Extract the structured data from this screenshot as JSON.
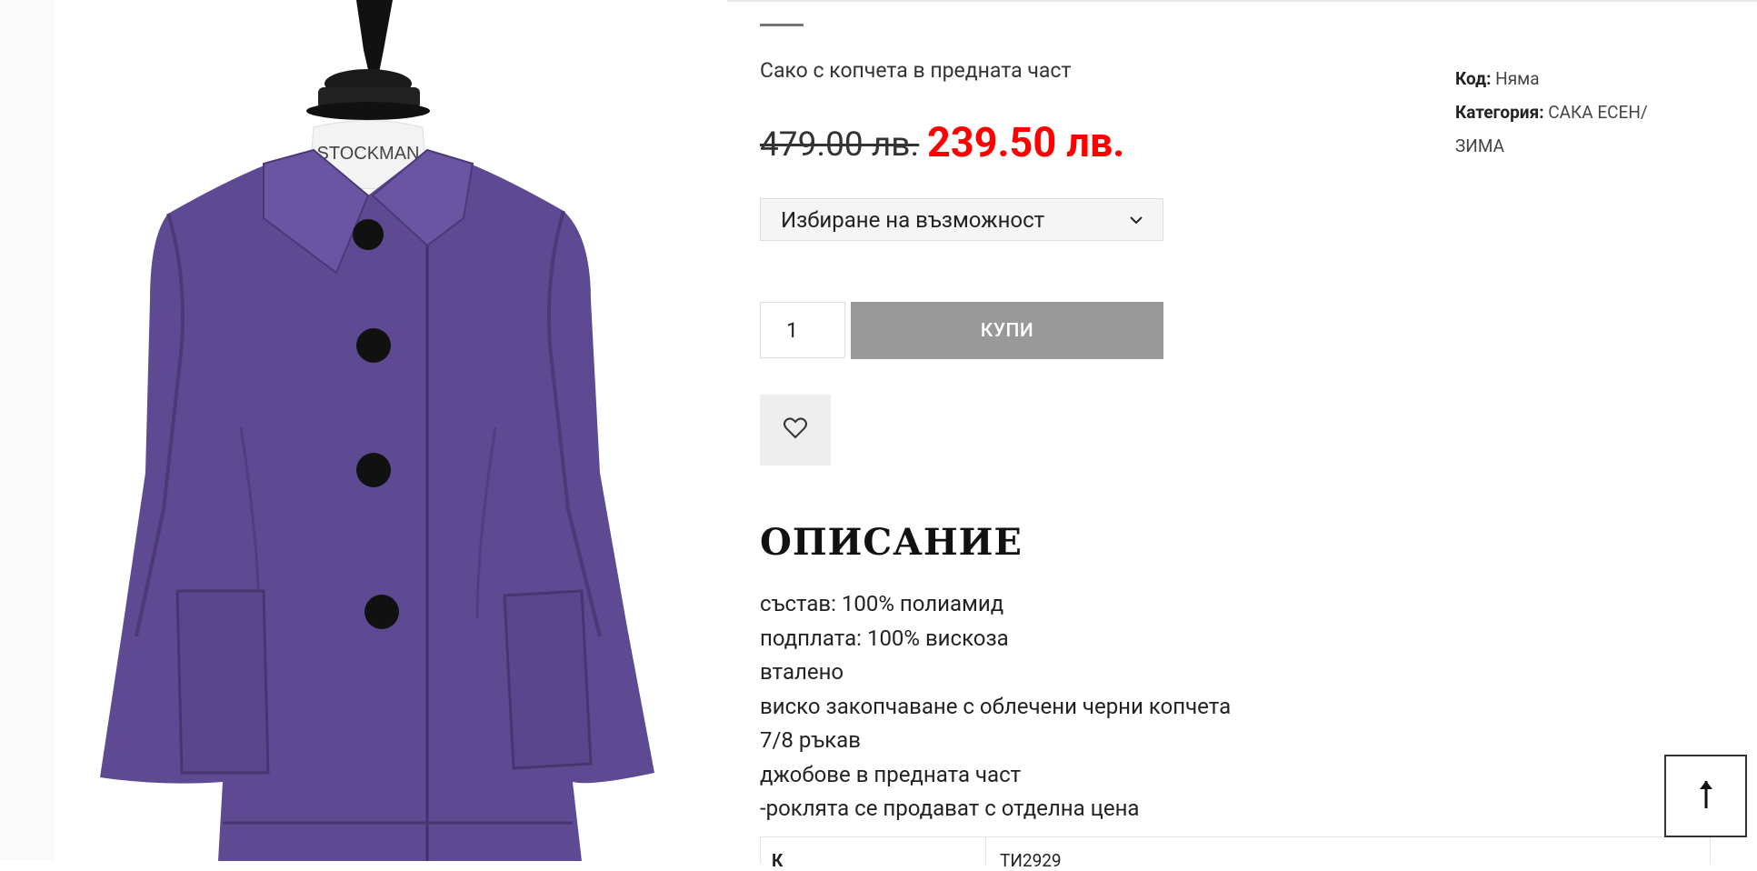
{
  "product": {
    "title": "Сако с копчета в предната част",
    "price_old": "479.00 лв.",
    "price_new": "239.50 лв.",
    "select_label": "Избиране на възможност",
    "quantity": "1",
    "buy_label": "КУПИ",
    "mannequin_label": "STOCKMAN"
  },
  "meta": {
    "code_label": "Код:",
    "code_value": "Няма",
    "category_label": "Категория:",
    "category_value": "САКА ЕСЕН/ЗИМА"
  },
  "description": {
    "heading": "ОПИСАНИЕ",
    "lines": [
      "състав:  100% полиамид",
      "подплата: 100% вискоза",
      "вталено",
      "виско закопчаване с облечени черни копчета",
      "7/8 ръкав",
      "джобове в предната част",
      "-роклята се продават с отделна цена"
    ]
  },
  "table": {
    "row1_label": "К",
    "row1_value": "ТИ2929"
  },
  "icons": {
    "wishlist": "heart-icon",
    "select": "chevron-down-icon",
    "scroll": "arrow-up-icon"
  },
  "colors": {
    "sale_price": "#ff0000",
    "buy_button": "#999999",
    "jacket": "#5e4a93"
  }
}
